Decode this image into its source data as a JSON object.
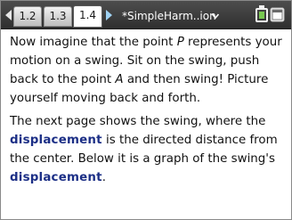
{
  "tabs": [
    {
      "label": "1.2"
    },
    {
      "label": "1.3"
    },
    {
      "label": "1.4",
      "active": true
    }
  ],
  "document_title": "*SimpleHarm..ion",
  "icons": {
    "prev": "chevron-left-icon",
    "next": "chevron-right-icon",
    "title_menu": "chevron-down-icon",
    "battery": "battery-icon",
    "window": "window-icon"
  },
  "colors": {
    "tabbar": "#3a3a3a",
    "keyword": "#1c2f86",
    "next_arrow": "#9fd2f3"
  },
  "paragraphs": {
    "p1": {
      "a": "Now imagine that the point ",
      "b": "P",
      "c": " represents your motion on a swing. Sit on the swing, push back to the point ",
      "d": "A",
      "e": " and then swing! Picture yourself moving back and forth."
    },
    "p2": {
      "a": "The next page shows the swing, where the ",
      "b": "displacement",
      "c": " is the directed distance from the center. Below it is a graph of the swing's ",
      "d": "displacement",
      "e": "."
    }
  }
}
